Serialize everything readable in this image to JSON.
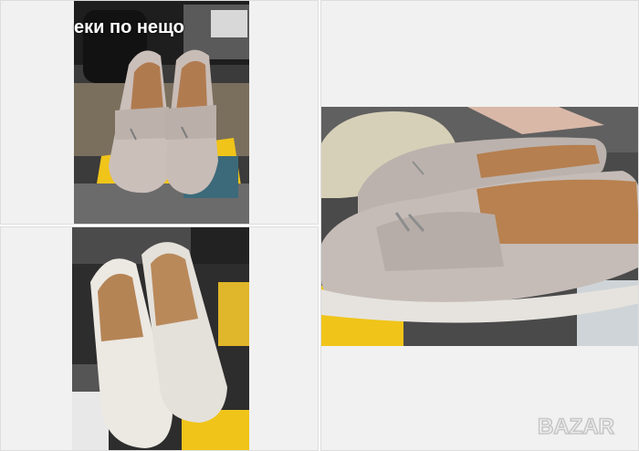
{
  "gallery": {
    "images": [
      {
        "alt": "Бежови мокасини на жълта стойка"
      },
      {
        "alt": "Бели мокасини"
      },
      {
        "alt": "Сиви велурени мокасини отблизо"
      }
    ]
  },
  "caption": {
    "text": "еки по нещо"
  },
  "watermark": {
    "text": "BAZAR"
  },
  "colors": {
    "panel_bg": "#f1f1f1",
    "suede_grey": "#c9bfba",
    "suede_white": "#ece8e2",
    "accent_yellow": "#f0c419",
    "sole": "#e6e3de"
  }
}
